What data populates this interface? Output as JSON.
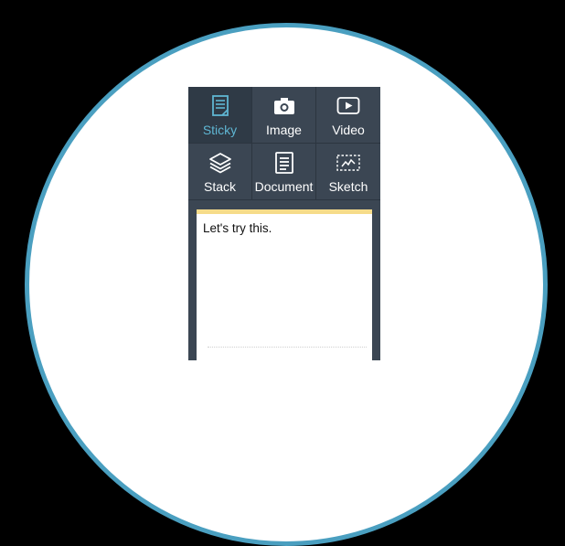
{
  "toolbar": {
    "items": [
      {
        "label": "Sticky",
        "icon": "sticky-note-icon",
        "active": true
      },
      {
        "label": "Image",
        "icon": "camera-icon",
        "active": false
      },
      {
        "label": "Video",
        "icon": "play-icon",
        "active": false
      },
      {
        "label": "Stack",
        "icon": "layers-icon",
        "active": false
      },
      {
        "label": "Document",
        "icon": "document-icon",
        "active": false
      },
      {
        "label": "Sketch",
        "icon": "sketch-icon",
        "active": false
      }
    ]
  },
  "sticky": {
    "text": "Let's try this."
  },
  "colors": {
    "panel": "#3b4653",
    "accent": "#5fb6d3",
    "sticky_strip": "#f6dc8a",
    "circle_border": "#4a9fc0"
  }
}
